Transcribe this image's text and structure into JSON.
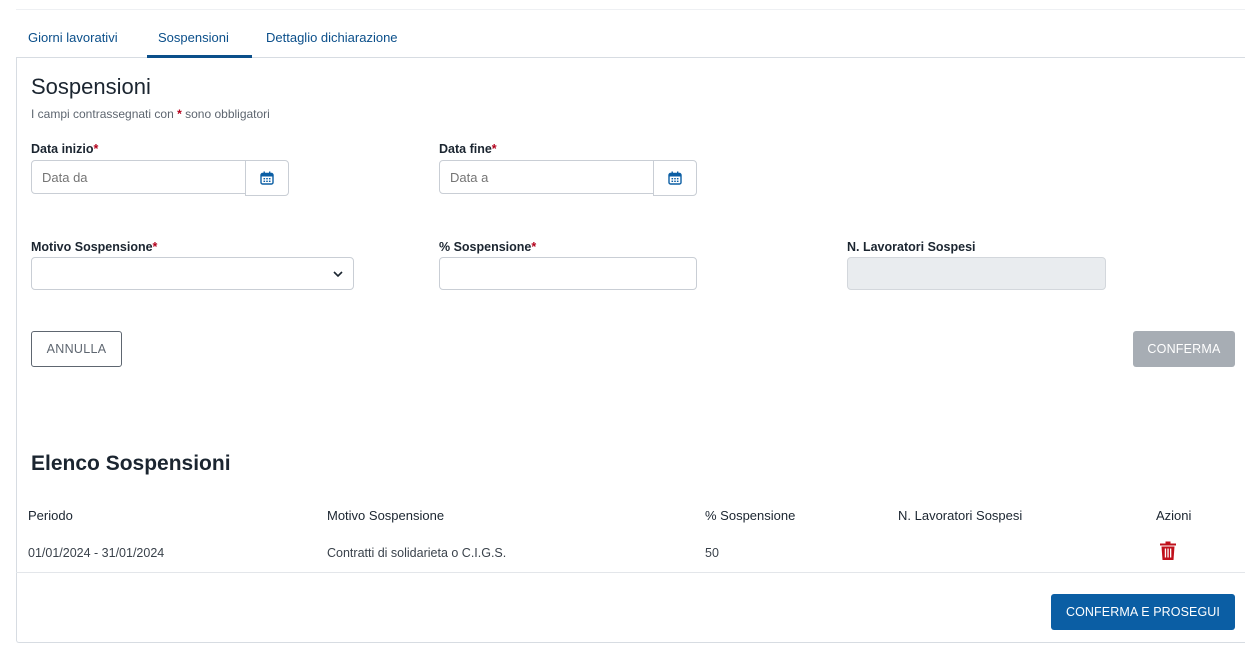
{
  "tabs": [
    {
      "label": "Giorni lavorativi"
    },
    {
      "label": "Sospensioni"
    },
    {
      "label": "Dettaglio dichiarazione"
    }
  ],
  "active_tab": "Sospensioni",
  "form": {
    "title": "Sospensioni",
    "required_note_prefix": "I campi contrassegnati con",
    "required_star": "*",
    "required_note_suffix": "sono obbligatori",
    "data_inizio": {
      "label": "Data inizio",
      "placeholder": "Data da",
      "value": ""
    },
    "data_fine": {
      "label": "Data fine",
      "placeholder": "Data a",
      "value": ""
    },
    "motivo": {
      "label": "Motivo Sospensione",
      "value": ""
    },
    "percentuale": {
      "label": "% Sospensione",
      "value": ""
    },
    "lavoratori": {
      "label": "N. Lavoratori Sospesi",
      "value": ""
    },
    "annulla_label": "ANNULLA",
    "conferma_label": "CONFERMA"
  },
  "list": {
    "title": "Elenco Sospensioni",
    "columns": [
      "Periodo",
      "Motivo Sospensione",
      "% Sospensione",
      "N. Lavoratori Sospesi",
      "Azioni"
    ],
    "rows": [
      {
        "periodo": "01/01/2024 - 31/01/2024",
        "motivo": "Contratti di solidarieta o C.I.G.S.",
        "percentuale": "50",
        "lavoratori": "",
        "action_icon": "trash-icon"
      }
    ]
  },
  "footer": {
    "conferma_prosegui_label": "CONFERMA E PROSEGUI"
  },
  "colors": {
    "primary": "#0b5ea4",
    "tab_text": "#0b4f8a",
    "required": "#b3001b",
    "delete": "#c0101b",
    "disabled_button": "#a7adb4"
  }
}
